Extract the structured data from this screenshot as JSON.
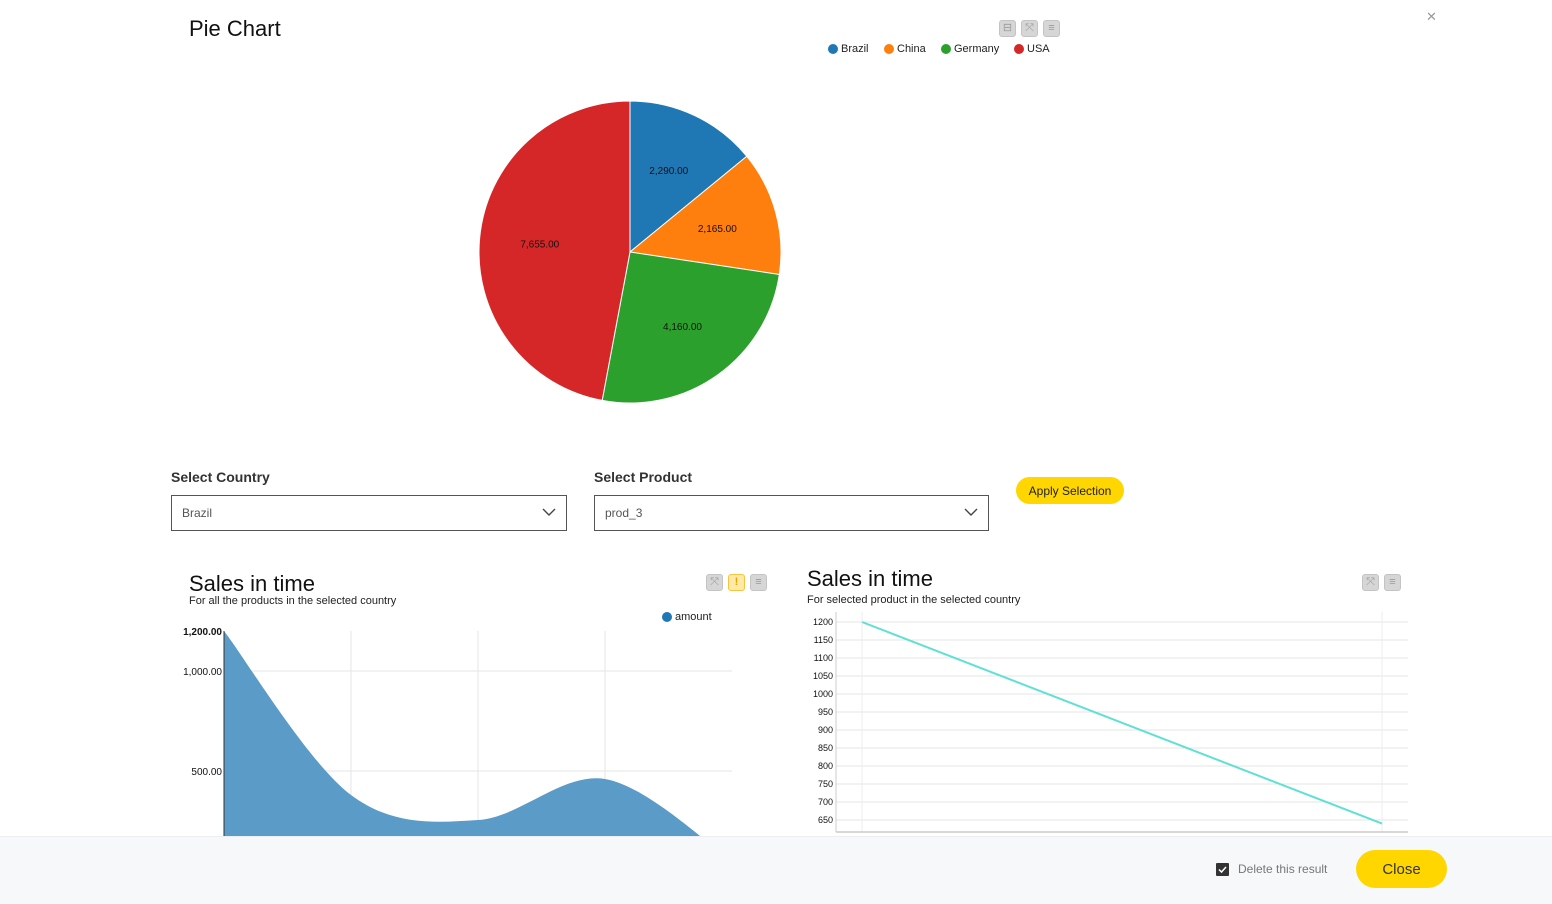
{
  "pie": {
    "title": "Pie Chart"
  },
  "filters": {
    "country_label": "Select Country",
    "country_value": "Brazil",
    "product_label": "Select Product",
    "product_value": "prod_3",
    "apply_label": "Apply Selection"
  },
  "area": {
    "title": "Sales in time",
    "subtitle": "For all the products in the selected country"
  },
  "line": {
    "title": "Sales in time",
    "subtitle": "For selected product in the selected country"
  },
  "footer": {
    "delete_label": "Delete this result",
    "delete_checked": true,
    "close_label": "Close"
  },
  "chart_data": [
    {
      "type": "pie",
      "title": "Pie Chart",
      "legend": "top-right",
      "categories": [
        "Brazil",
        "China",
        "Germany",
        "USA"
      ],
      "values": [
        2290,
        2165,
        4160,
        7655
      ],
      "labels": [
        "2,290.00",
        "2,165.00",
        "4,160.00",
        "7,655.00"
      ],
      "colors": [
        "#1f77b4",
        "#ff7f0e",
        "#2ca02c",
        "#d62728"
      ]
    },
    {
      "type": "area",
      "title": "Sales in time",
      "subtitle": "For all the products in the selected country",
      "series": [
        {
          "name": "amount",
          "values": [
            1200,
            380,
            255,
            460,
            50
          ]
        }
      ],
      "color": "#5b9bc8",
      "legend": "top-right",
      "grid": true,
      "yticks": [
        500,
        1000,
        1200
      ],
      "ytick_labels": [
        "500.00",
        "1,000.00",
        "1,200.00"
      ],
      "ylim": [
        0,
        1200
      ]
    },
    {
      "type": "line",
      "title": "Sales in time",
      "subtitle": "For selected product in the selected country",
      "series": [
        {
          "values": [
            1200,
            640
          ]
        }
      ],
      "color": "#5fe0d4",
      "grid": true,
      "yticks": [
        650,
        700,
        750,
        800,
        850,
        900,
        950,
        1000,
        1050,
        1100,
        1150,
        1200
      ],
      "ylim": [
        630,
        1220
      ]
    }
  ]
}
